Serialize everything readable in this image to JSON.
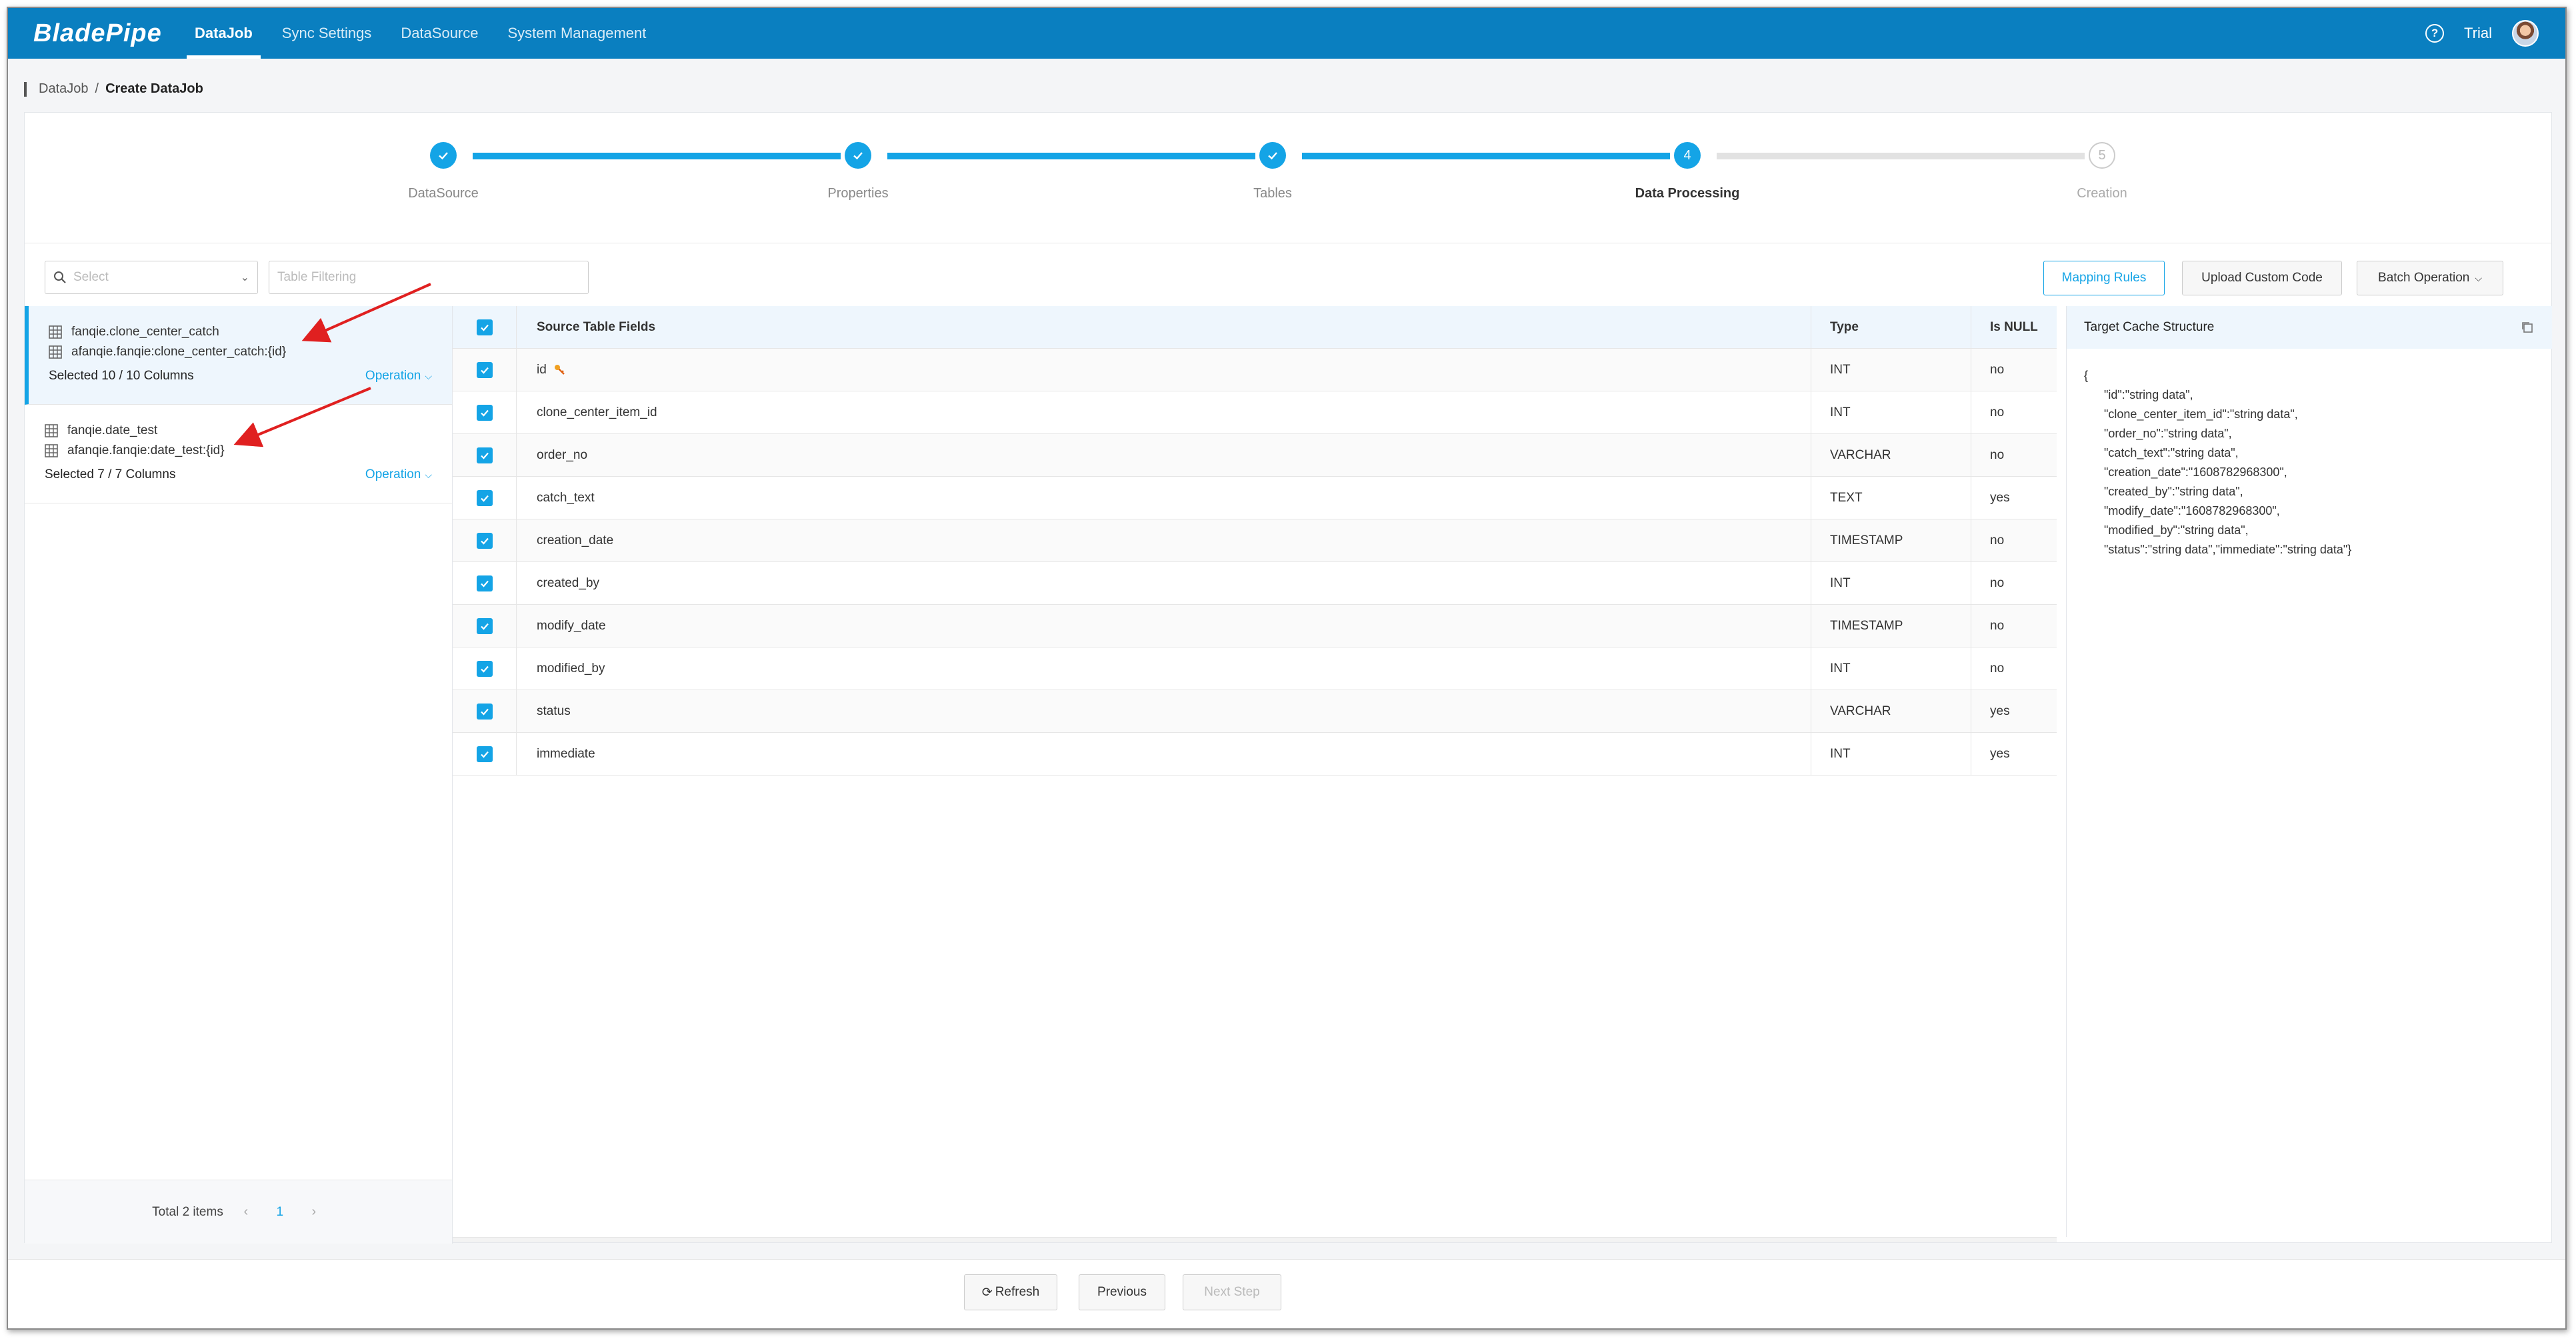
{
  "app": {
    "logo": "BladePipe"
  },
  "nav": {
    "items": [
      {
        "label": "DataJob",
        "active": true
      },
      {
        "label": "Sync Settings",
        "active": false
      },
      {
        "label": "DataSource",
        "active": false
      },
      {
        "label": "System Management",
        "active": false
      }
    ],
    "help_icon": "question-circle-icon",
    "user_label": "Trial"
  },
  "breadcrumb": {
    "root": "DataJob",
    "separator": "/",
    "current": "Create DataJob"
  },
  "steps": [
    {
      "label": "DataSource",
      "status": "done"
    },
    {
      "label": "Properties",
      "status": "done"
    },
    {
      "label": "Tables",
      "status": "done"
    },
    {
      "label": "Data Processing",
      "status": "active",
      "number": "4"
    },
    {
      "label": "Creation",
      "status": "todo",
      "number": "5"
    }
  ],
  "toolbar": {
    "select_placeholder": "Select",
    "filter_placeholder": "Table Filtering",
    "mapping_rules": "Mapping Rules",
    "upload_custom_code": "Upload Custom Code",
    "batch_operation": "Batch Operation"
  },
  "tables": [
    {
      "source": "fanqie.clone_center_catch",
      "target": "afanqie.fanqie:clone_center_catch:{id}",
      "selected": "Selected 10 / 10 Columns",
      "operation": "Operation",
      "active": true
    },
    {
      "source": "fanqie.date_test",
      "target": "afanqie.fanqie:date_test:{id}",
      "selected": "Selected 7 / 7 Columns",
      "operation": "Operation",
      "active": false
    }
  ],
  "pagination": {
    "total": "Total 2 items",
    "current": "1"
  },
  "fields_table": {
    "headers": {
      "name": "Source Table Fields",
      "type": "Type",
      "is_null": "Is NULL"
    },
    "rows": [
      {
        "name": "id",
        "type": "INT",
        "is_null": "no",
        "primary_key": true
      },
      {
        "name": "clone_center_item_id",
        "type": "INT",
        "is_null": "no"
      },
      {
        "name": "order_no",
        "type": "VARCHAR",
        "is_null": "no"
      },
      {
        "name": "catch_text",
        "type": "TEXT",
        "is_null": "yes"
      },
      {
        "name": "creation_date",
        "type": "TIMESTAMP",
        "is_null": "no"
      },
      {
        "name": "created_by",
        "type": "INT",
        "is_null": "no"
      },
      {
        "name": "modify_date",
        "type": "TIMESTAMP",
        "is_null": "no"
      },
      {
        "name": "modified_by",
        "type": "INT",
        "is_null": "no"
      },
      {
        "name": "status",
        "type": "VARCHAR",
        "is_null": "yes"
      },
      {
        "name": "immediate",
        "type": "INT",
        "is_null": "yes"
      }
    ]
  },
  "preview": {
    "title": "Target Cache Structure",
    "content": "{\n      \"id\":\"string data\",\n      \"clone_center_item_id\":\"string data\",\n      \"order_no\":\"string data\",\n      \"catch_text\":\"string data\",\n      \"creation_date\":\"1608782968300\",\n      \"created_by\":\"string data\",\n      \"modify_date\":\"1608782968300\",\n      \"modified_by\":\"string data\",\n      \"status\":\"string data\",\"immediate\":\"string data\"}"
  },
  "footer": {
    "refresh": "Refresh",
    "previous": "Previous",
    "next": "Next Step"
  },
  "colors": {
    "nav_bg": "#0a7fc0",
    "accent": "#14a4e6",
    "annotation": "#e02020"
  }
}
